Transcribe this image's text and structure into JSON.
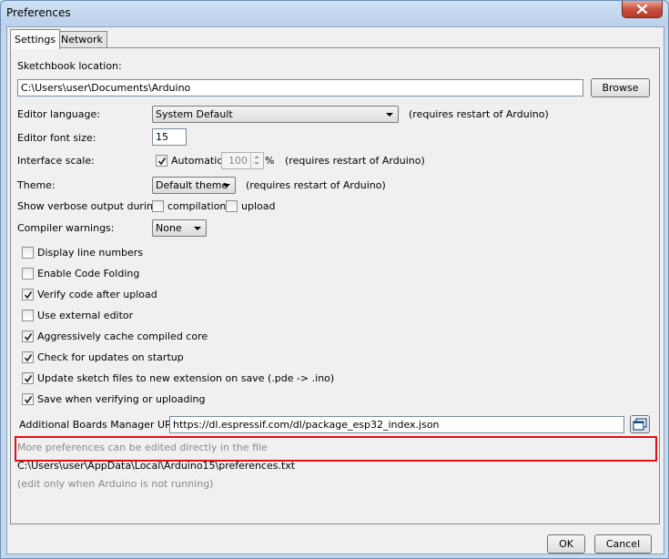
{
  "window": {
    "title": "Preferences"
  },
  "tabs": [
    {
      "label": "Settings",
      "active": true
    },
    {
      "label": "Network",
      "active": false
    }
  ],
  "sketchbook": {
    "label": "Sketchbook location:",
    "value": "C:\\Users\\user\\Documents\\Arduino",
    "browse": "Browse"
  },
  "editor_language": {
    "label": "Editor language:",
    "value": "System Default",
    "note": "(requires restart of Arduino)"
  },
  "font_size": {
    "label": "Editor font size:",
    "value": "15"
  },
  "interface_scale": {
    "label": "Interface scale:",
    "automatic_label": "Automatic",
    "automatic_checked": true,
    "value": "100",
    "unit": "%",
    "note": "(requires restart of Arduino)"
  },
  "theme": {
    "label": "Theme:",
    "value": "Default theme",
    "note": "(requires restart of Arduino)"
  },
  "verbose": {
    "label": "Show verbose output during:",
    "compilation_label": "compilation",
    "compilation_checked": false,
    "upload_label": "upload",
    "upload_checked": false
  },
  "compiler_warnings": {
    "label": "Compiler warnings:",
    "value": "None"
  },
  "options": [
    {
      "label": "Display line numbers",
      "checked": false
    },
    {
      "label": "Enable Code Folding",
      "checked": false
    },
    {
      "label": "Verify code after upload",
      "checked": true
    },
    {
      "label": "Use external editor",
      "checked": false
    },
    {
      "label": "Aggressively cache compiled core",
      "checked": true
    },
    {
      "label": "Check for updates on startup",
      "checked": true
    },
    {
      "label": "Update sketch files to new extension on save (.pde -> .ino)",
      "checked": true
    },
    {
      "label": "Save when verifying or uploading",
      "checked": true
    }
  ],
  "boards_urls": {
    "label": "Additional Boards Manager URLs:",
    "value": "https://dl.espressif.com/dl/package_esp32_index.json"
  },
  "footer_info": {
    "more_prefs": "More preferences can be edited directly in the file",
    "path": "C:\\Users\\user\\AppData\\Local\\Arduino15\\preferences.txt",
    "edit_note": "(edit only when Arduino is not running)"
  },
  "buttons": {
    "ok": "OK",
    "cancel": "Cancel"
  },
  "colors": {
    "highlight": "#e0101a",
    "close_button": "#c75140"
  }
}
